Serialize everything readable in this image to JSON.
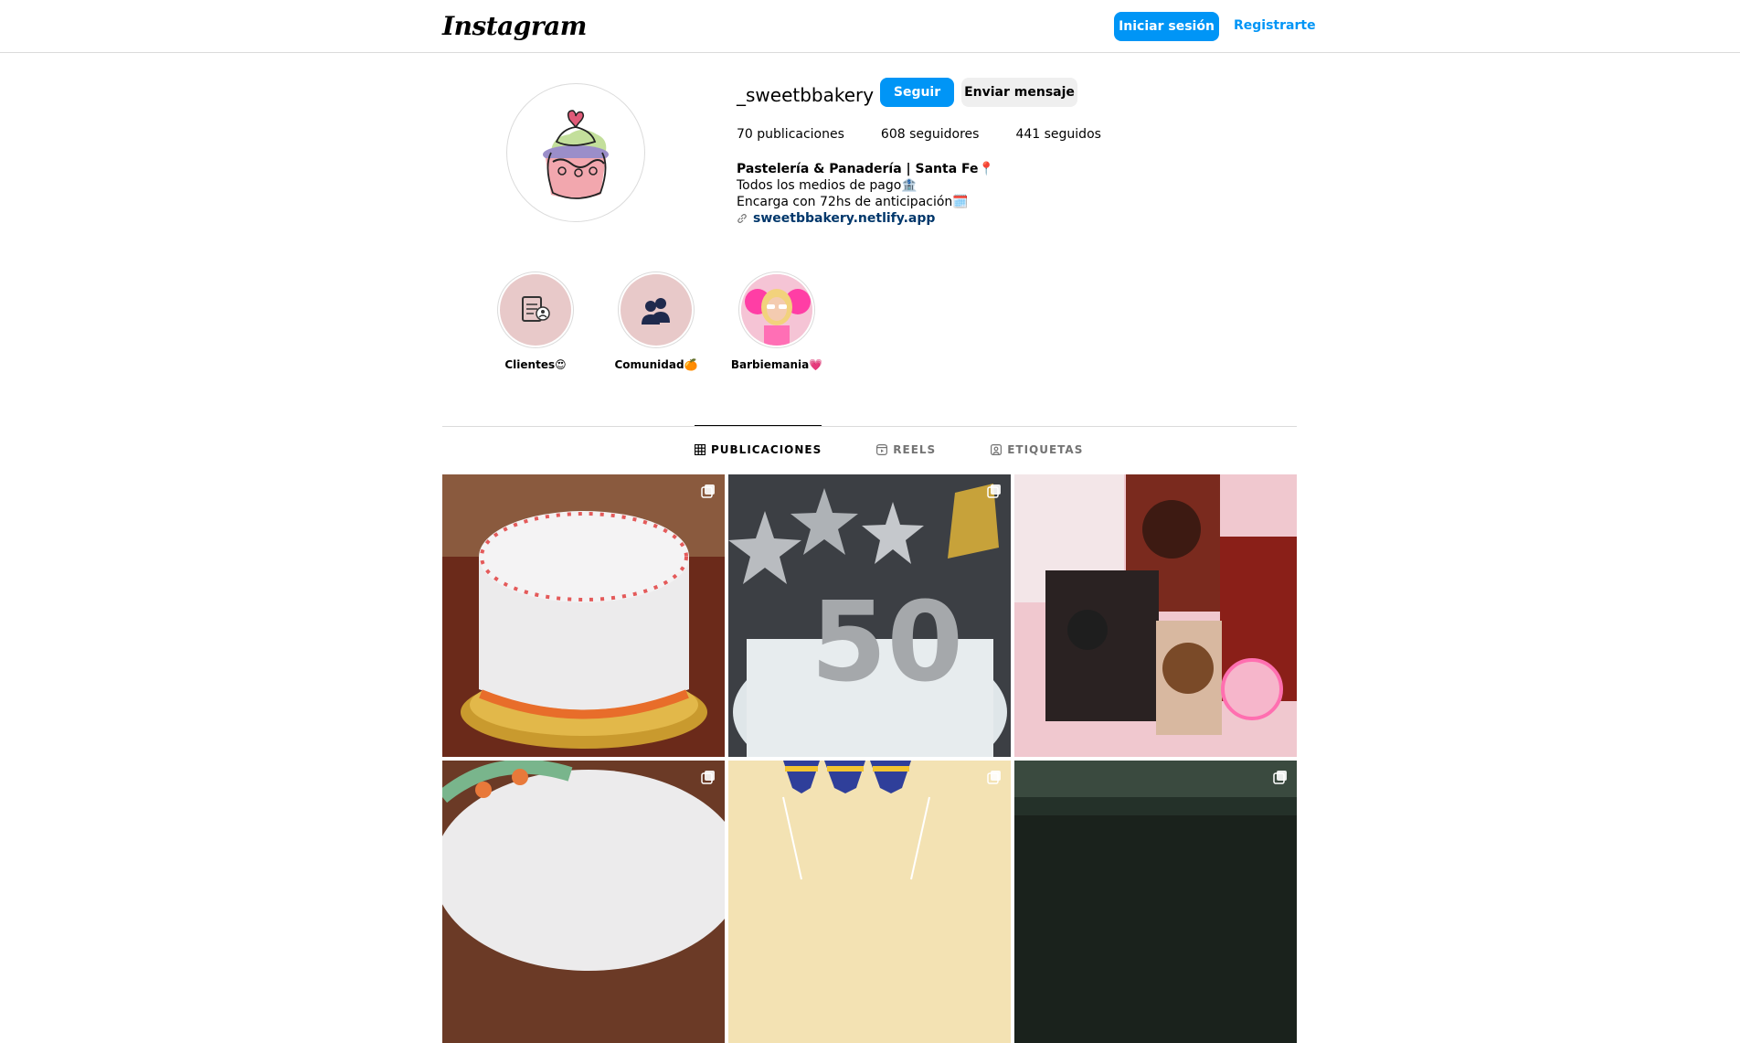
{
  "header": {
    "logo": "Instagram",
    "login_label": "Iniciar sesión",
    "register_label": "Registrarte"
  },
  "profile": {
    "username": "_sweetbbakery",
    "follow_label": "Seguir",
    "message_label": "Enviar mensaje",
    "stats": {
      "posts": "70 publicaciones",
      "followers": "608 seguidores",
      "following": "441 seguidos"
    },
    "bio": {
      "name": "Pastelería & Panadería | Santa Fe📍",
      "line1": "Todos los medios de pago🏦",
      "line2": "Encarga con 72hs de anticipación🗓️",
      "link": "sweetbbakery.netlify.app"
    }
  },
  "highlights": [
    {
      "label": "Clientes😍"
    },
    {
      "label": "Comunidad🍊"
    },
    {
      "label": "Barbiemania💗"
    }
  ],
  "tabs": [
    {
      "label": "PUBLICACIONES"
    },
    {
      "label": "REELS"
    },
    {
      "label": "ETIQUETAS"
    }
  ],
  "colors": {
    "accent": "#0095f6",
    "link": "#00376b",
    "border": "#dbdbdb"
  }
}
